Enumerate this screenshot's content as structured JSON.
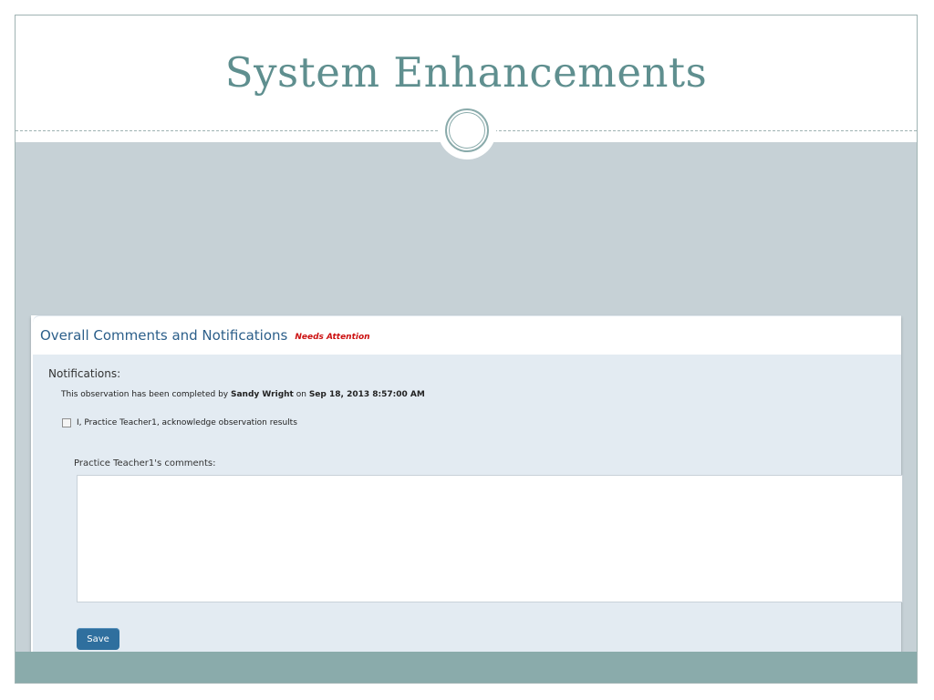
{
  "slide": {
    "title": "System Enhancements"
  },
  "panel": {
    "title": "Overall Comments and Notifications",
    "badge": "Needs Attention",
    "notifications_label": "Notifications:",
    "completed_prefix": "This observation has been completed by",
    "completed_by": "Sandy Wright",
    "completed_on_word": "on",
    "completed_date": "Sep 18, 2013 8:57:00 AM",
    "acknowledge_label": "I, Practice Teacher1, acknowledge observation results",
    "acknowledge_checked": false,
    "comments_label": "Practice Teacher1's comments:",
    "comments_value": "",
    "save_label": "Save"
  },
  "colors": {
    "title": "#5f8f8f",
    "content_band": "#c6d1d6",
    "bottom_band": "#8aabab",
    "panel_title": "#2c5f8a",
    "badge": "#cc1111",
    "save_button": "#2f6f9e"
  }
}
